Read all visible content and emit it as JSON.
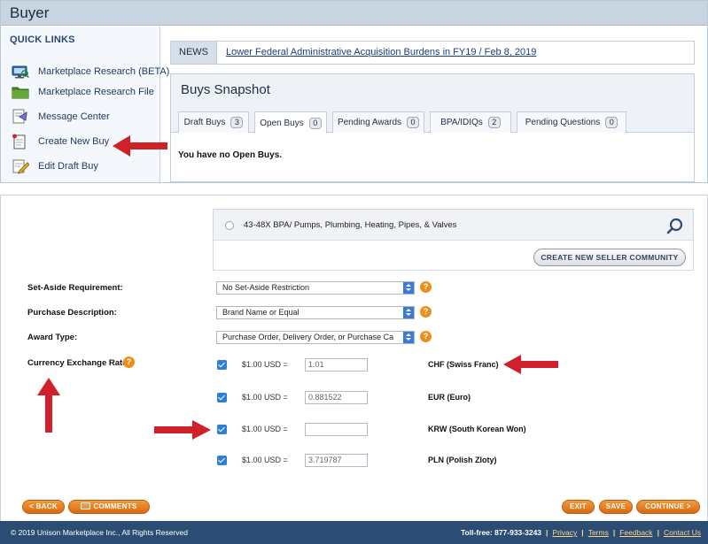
{
  "top": {
    "title": "Buyer",
    "quick_links": {
      "title": "QUICK LINKS",
      "items": [
        {
          "label": "Marketplace Research (BETA)",
          "icon": "monitor-icon"
        },
        {
          "label": "Marketplace Research File",
          "icon": "folder-icon"
        },
        {
          "label": "Message Center",
          "icon": "message-icon"
        },
        {
          "label": "Create New Buy",
          "icon": "new-document-icon"
        },
        {
          "label": "Edit Draft Buy",
          "icon": "edit-document-icon"
        }
      ]
    },
    "news": {
      "label": "NEWS",
      "headline": "Lower Federal Administrative Acquisition Burdens in FY19 / Feb 8, 2019"
    },
    "snapshot": {
      "title": "Buys Snapshot",
      "tabs": [
        {
          "label": "Draft Buys",
          "count": "3"
        },
        {
          "label": "Open Buys",
          "count": "0"
        },
        {
          "label": "Pending Awards",
          "count": "0"
        },
        {
          "label": "BPA/IDIQs",
          "count": "2"
        },
        {
          "label": "Pending Questions",
          "count": "0"
        }
      ],
      "empty_message": "You have no Open Buys."
    }
  },
  "form": {
    "community": {
      "option_label": "43-48X BPA/ Pumps, Plumbing, Heating, Pipes, & Valves",
      "create_button": "CREATE NEW SELLER COMMUNITY"
    },
    "set_aside": {
      "label": "Set-Aside Requirement:",
      "value": "No Set-Aside Restriction"
    },
    "purchase_description": {
      "label": "Purchase Description:",
      "value": "Brand Name or Equal"
    },
    "award_type": {
      "label": "Award Type:",
      "value": "Purchase Order, Delivery Order, or Purchase Ca"
    },
    "currency": {
      "label": "Currency Exchange Rate:",
      "base": "$1.00  USD  =",
      "rows": [
        {
          "rate": "1.01",
          "name": "CHF (Swiss Franc)",
          "checked": true
        },
        {
          "rate": "0.881522",
          "name": "EUR (Euro)",
          "checked": true
        },
        {
          "rate": "",
          "name": "KRW (South Korean Won)",
          "checked": true
        },
        {
          "rate": "3.719787",
          "name": "PLN (Polish Zloty)",
          "checked": true
        }
      ]
    },
    "help_symbol": "?"
  },
  "buttons": {
    "back": "< BACK",
    "comments": "COMMENTS",
    "exit": "EXIT",
    "save": "SAVE",
    "continue": "CONTINUE >"
  },
  "footer": {
    "copyright": "© 2019 Unison Marketplace Inc., All Rights Reserved",
    "toll_free": "Toll-free: 877-933-3243",
    "separator": "|",
    "links": [
      "Privacy",
      "Terms",
      "Feedback",
      "Contact Us"
    ]
  },
  "colors": {
    "accent_orange": "#e57d1f",
    "annotation_red": "#d0202a",
    "footer_blue": "#2c4d73",
    "checkbox_blue": "#2f7ed8"
  }
}
